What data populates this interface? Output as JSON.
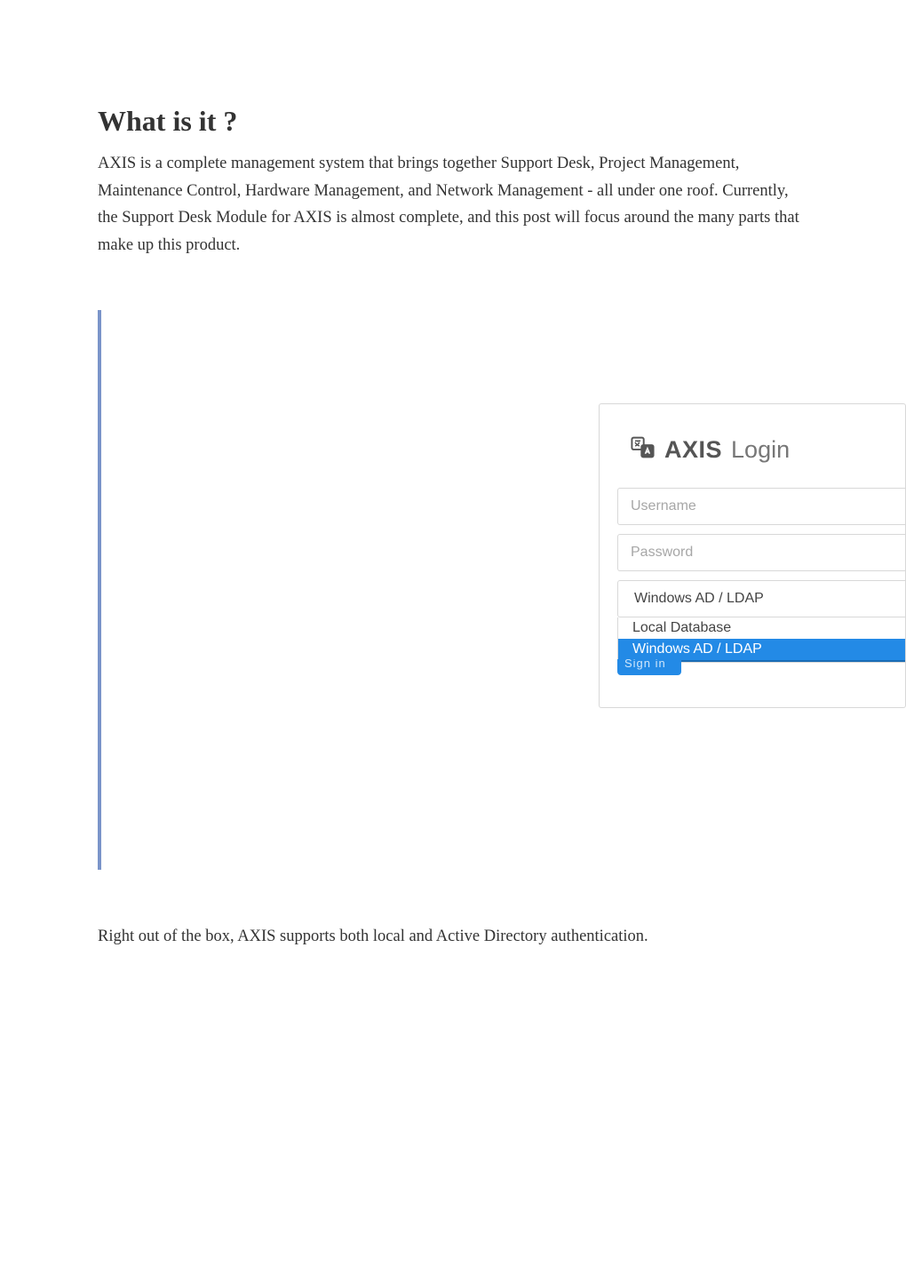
{
  "heading": "What is it ?",
  "intro_paragraph": "AXIS is a complete management system that brings together Support Desk, Project Management, Maintenance Control, Hardware Management, and Network Management - all under one roof.  Currently, the Support Desk Module for AXIS is almost complete, and this post will focus around the many parts that make up this product.",
  "login_card": {
    "brand": "AXIS",
    "title_word": "Login",
    "username_placeholder": "Username",
    "password_placeholder": "Password",
    "select_value": "Windows AD / LDAP",
    "options": {
      "opt0": "Local Database",
      "opt1": "Windows AD / LDAP"
    },
    "signin_fragment": "Sign in"
  },
  "caption": "Right out of the box, AXIS supports both local and Active Directory authentication."
}
